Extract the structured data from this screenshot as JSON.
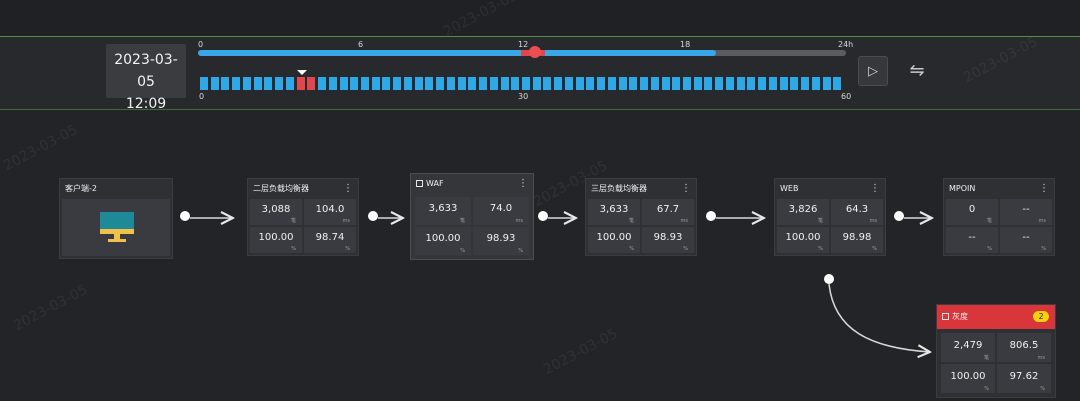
{
  "timebar": {
    "date": "2023-03-05",
    "time": "12:09",
    "hour_ticks": [
      "0",
      "6",
      "12",
      "18",
      "24h"
    ],
    "minute_ticks": [
      "0",
      "30",
      "60"
    ],
    "hour_progress_fraction": 0.8,
    "hour_cursor_fraction": 0.52,
    "minute_segments": 60,
    "minute_red_segments": [
      9,
      10
    ],
    "colors": {
      "accent": "#3aa6e6",
      "alert": "#e0474c"
    }
  },
  "nodes": {
    "client": {
      "title": "客户端-2"
    },
    "lb2": {
      "title": "二层负载均衡器",
      "v1": "3,088",
      "u1": "笔",
      "v2": "104.0",
      "u2": "ms",
      "v3": "100.00",
      "u3": "%",
      "v4": "98.74",
      "u4": "%"
    },
    "waf": {
      "title": "WAF",
      "v1": "3,633",
      "u1": "笔",
      "v2": "74.0",
      "u2": "ms",
      "v3": "100.00",
      "u3": "%",
      "v4": "98.93",
      "u4": "%"
    },
    "lb3": {
      "title": "三层负载均衡器",
      "v1": "3,633",
      "u1": "笔",
      "v2": "67.7",
      "u2": "ms",
      "v3": "100.00",
      "u3": "%",
      "v4": "98.93",
      "u4": "%"
    },
    "web": {
      "title": "WEB",
      "v1": "3,826",
      "u1": "笔",
      "v2": "64.3",
      "u2": "ms",
      "v3": "100.00",
      "u3": "%",
      "v4": "98.98",
      "u4": "%"
    },
    "mpoin": {
      "title": "MPOIN",
      "v1": "0",
      "u1": "笔",
      "v2": "--",
      "u2": "ms",
      "v3": "--",
      "u3": "%",
      "v4": "--",
      "u4": "%"
    },
    "gray": {
      "title": "灰度",
      "badge": "2",
      "v1": "2,479",
      "u1": "笔",
      "v2": "806.5",
      "u2": "ms",
      "v3": "100.00",
      "u3": "%",
      "v4": "97.62",
      "u4": "%"
    }
  }
}
